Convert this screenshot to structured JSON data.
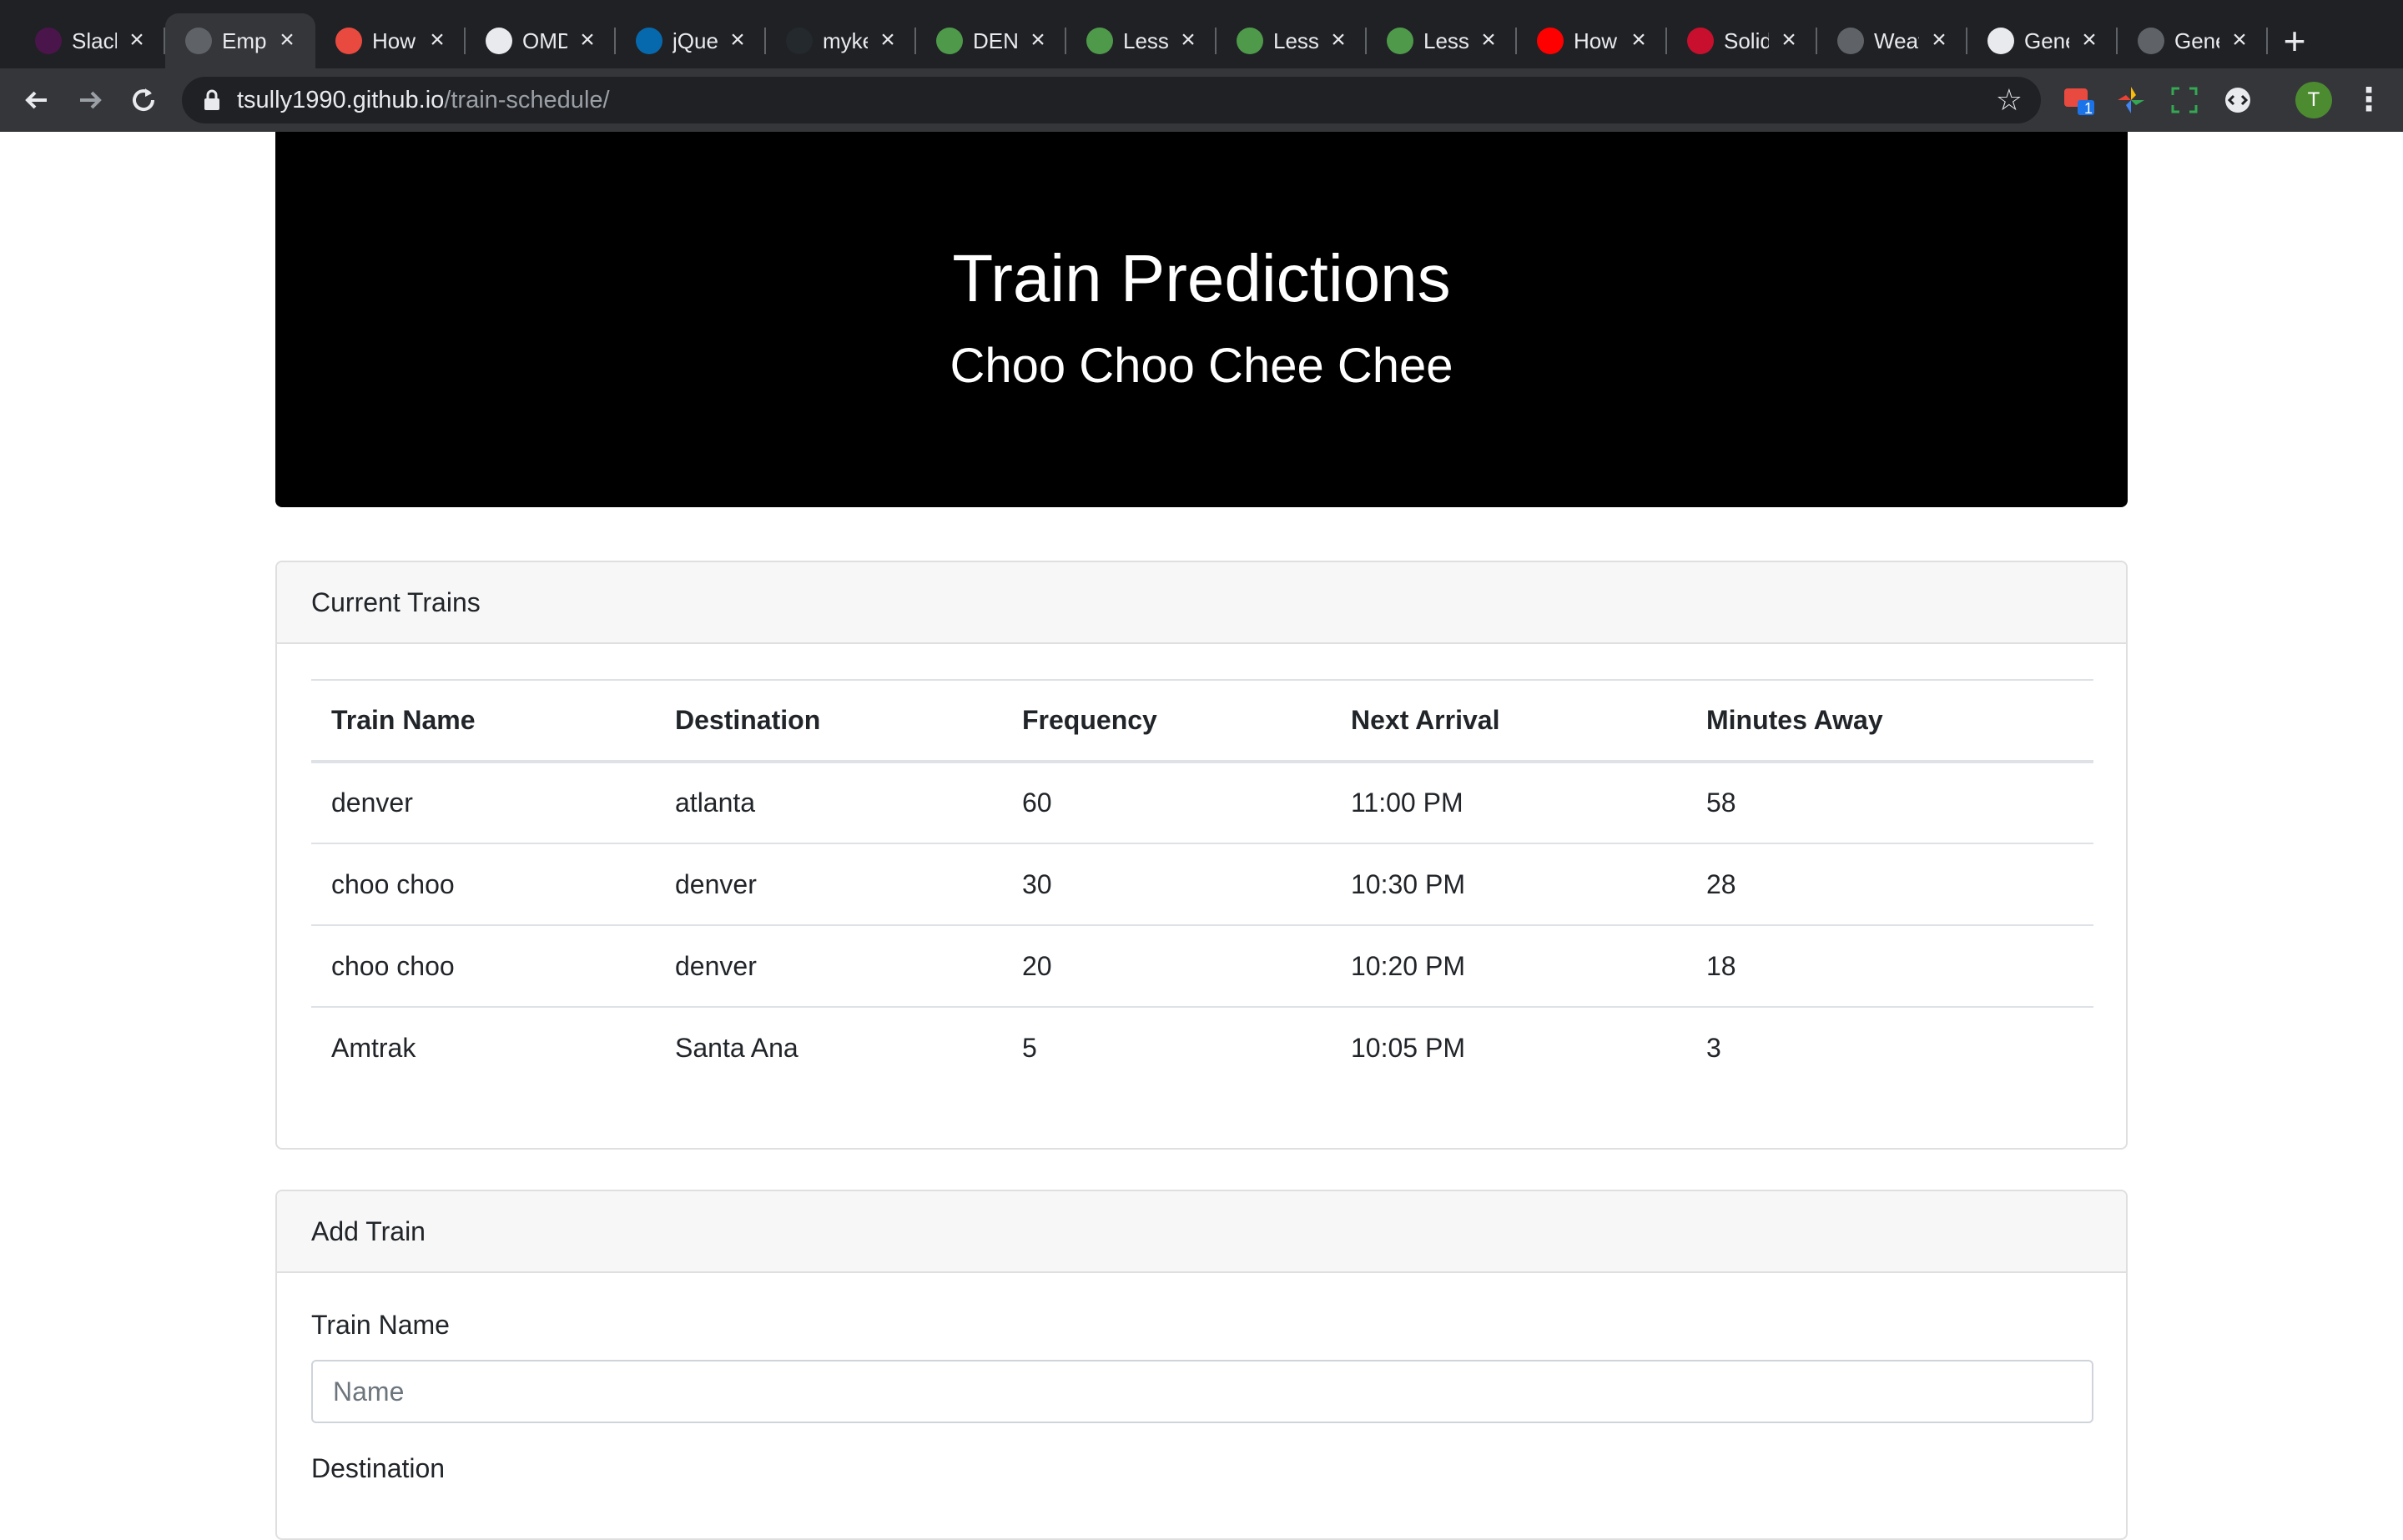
{
  "browser": {
    "tabs": [
      {
        "title": "Slack",
        "icon": "slack-icon",
        "color": "#4a154b"
      },
      {
        "title": "Employee",
        "icon": "globe-icon",
        "color": "#5f6368",
        "active": true
      },
      {
        "title": "How",
        "icon": "codecademy-icon",
        "color": "#e94a3f"
      },
      {
        "title": "OMDb",
        "icon": "omdb-icon",
        "color": "#e8eaed"
      },
      {
        "title": "jQuery",
        "icon": "jquery-icon",
        "color": "#0769ad"
      },
      {
        "title": "mykey",
        "icon": "github-icon",
        "color": "#24292e"
      },
      {
        "title": "DEN",
        "icon": "cube-icon",
        "color": "#4e9a4a"
      },
      {
        "title": "Less",
        "icon": "cube-icon",
        "color": "#4e9a4a"
      },
      {
        "title": "Less",
        "icon": "cube-icon",
        "color": "#4e9a4a"
      },
      {
        "title": "Less",
        "icon": "cube-icon",
        "color": "#4e9a4a"
      },
      {
        "title": "How",
        "icon": "youtube-icon",
        "color": "#ff0000"
      },
      {
        "title": "Solid",
        "icon": "hsu-icon",
        "color": "#c8102e"
      },
      {
        "title": "Weather",
        "icon": "globe-icon",
        "color": "#5f6368"
      },
      {
        "title": "General",
        "icon": "globe-icon",
        "color": "#e8eaed"
      },
      {
        "title": "General",
        "icon": "globe-icon",
        "color": "#5f6368"
      }
    ],
    "url_host": "tsully1990.github.io",
    "url_path": "/train-schedule/",
    "profile_initial": "T",
    "extension_badge": "1"
  },
  "header": {
    "title": "Train Predictions",
    "subtitle": "Choo Choo Chee Chee"
  },
  "current_trains": {
    "heading": "Current Trains",
    "columns": [
      "Train Name",
      "Destination",
      "Frequency",
      "Next Arrival",
      "Minutes Away"
    ],
    "rows": [
      [
        "denver",
        "atlanta",
        "60",
        "11:00 PM",
        "58"
      ],
      [
        "choo choo",
        "denver",
        "30",
        "10:30 PM",
        "28"
      ],
      [
        "choo choo",
        "denver",
        "20",
        "10:20 PM",
        "18"
      ],
      [
        "Amtrak",
        "Santa Ana",
        "5",
        "10:05 PM",
        "3"
      ]
    ]
  },
  "add_train": {
    "heading": "Add Train",
    "train_name_label": "Train Name",
    "train_name_placeholder": "Name",
    "destination_label": "Destination"
  }
}
